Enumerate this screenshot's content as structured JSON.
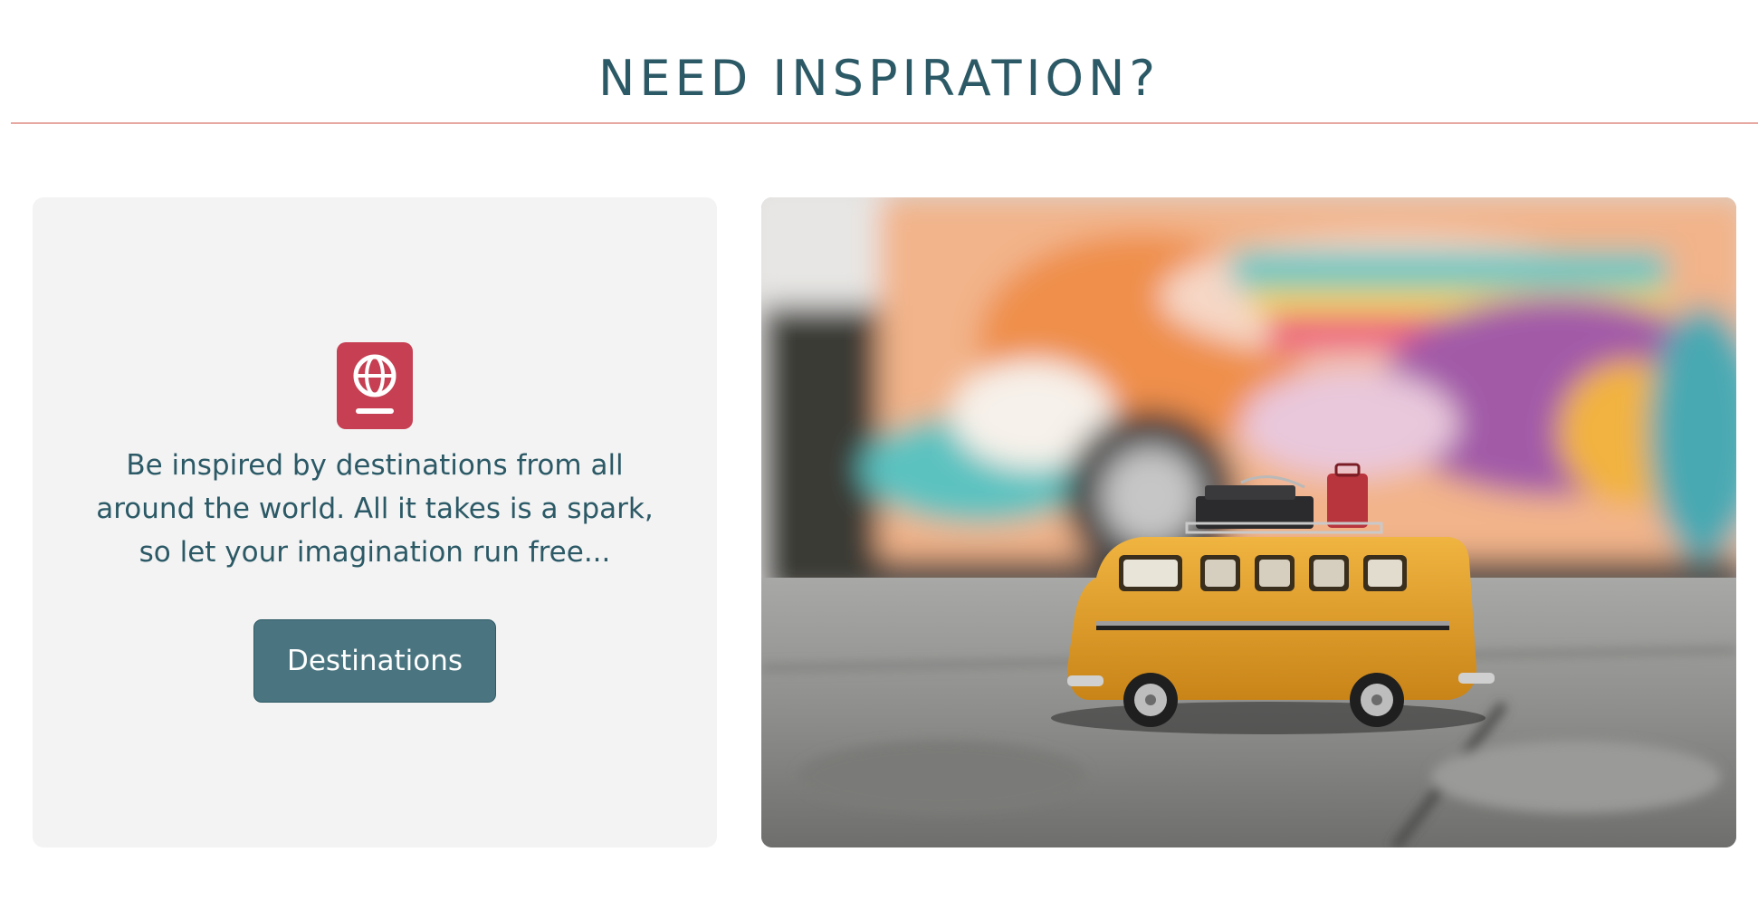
{
  "section": {
    "title": "NEED INSPIRATION?"
  },
  "card": {
    "icon": "passport-globe-icon",
    "text": "Be inspired by destinations from all around the world. All it takes is a spark, so let your imagination run free...",
    "button_label": "Destinations"
  },
  "photo": {
    "subject": "toy-bus-with-luggage"
  },
  "colors": {
    "heading": "#2c5966",
    "rule": "#e7a8a2",
    "card_background": "#f3f3f3",
    "icon_background": "#c63f52",
    "button_background": "#4a7580",
    "button_text": "#ffffff"
  }
}
